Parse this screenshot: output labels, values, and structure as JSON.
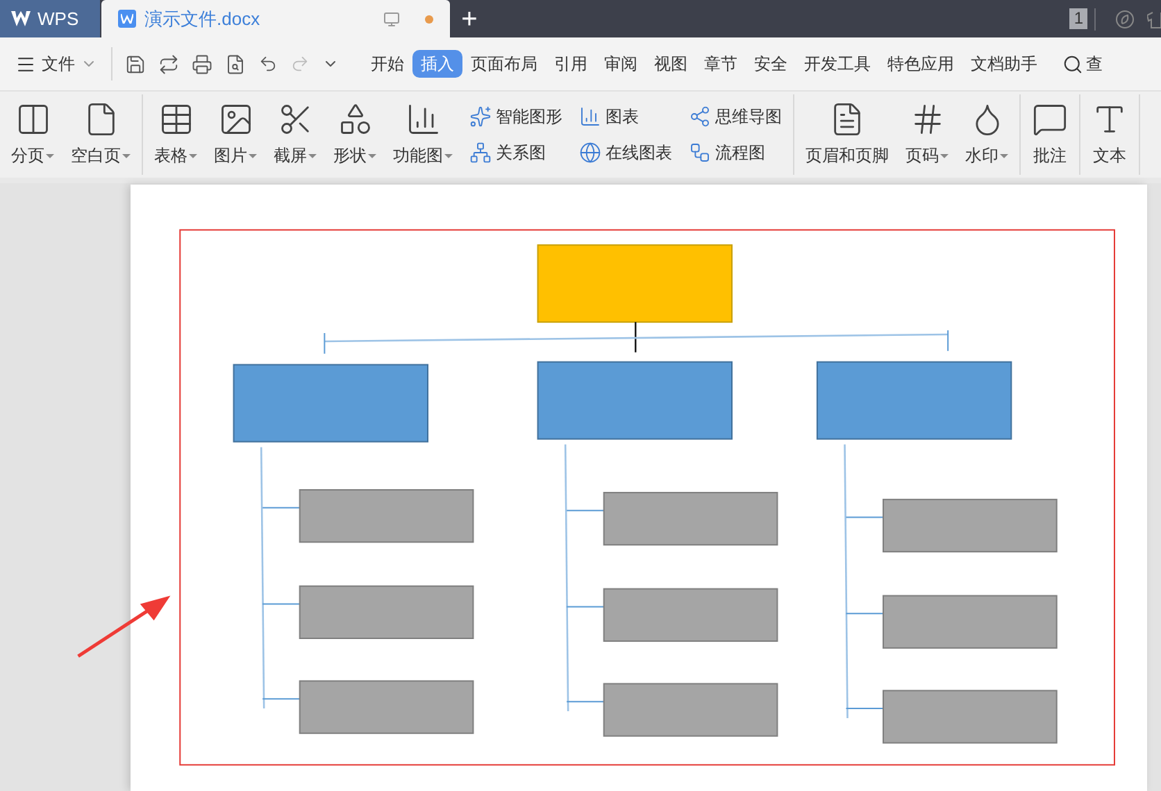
{
  "title_bar": {
    "app_tab": "WPS",
    "document_tab": {
      "title": "演示文件.docx",
      "modified": true
    },
    "new_tab": "+",
    "page_count": "1"
  },
  "menu_bar": {
    "file_menu": "文件",
    "tabs": [
      {
        "label": "开始",
        "selected": false
      },
      {
        "label": "插入",
        "selected": true
      },
      {
        "label": "页面布局",
        "selected": false
      },
      {
        "label": "引用",
        "selected": false
      },
      {
        "label": "审阅",
        "selected": false
      },
      {
        "label": "视图",
        "selected": false
      },
      {
        "label": "章节",
        "selected": false
      },
      {
        "label": "安全",
        "selected": false
      },
      {
        "label": "开发工具",
        "selected": false
      },
      {
        "label": "特色应用",
        "selected": false
      },
      {
        "label": "文档助手",
        "selected": false
      }
    ],
    "search": "查"
  },
  "ribbon": {
    "groups": [
      {
        "items": [
          {
            "kind": "large",
            "label": "分页",
            "dropdown": true
          },
          {
            "kind": "large",
            "label": "空白页",
            "dropdown": true
          }
        ]
      },
      {
        "items": [
          {
            "kind": "large",
            "label": "表格",
            "dropdown": true
          },
          {
            "kind": "large",
            "label": "图片",
            "dropdown": true
          },
          {
            "kind": "large",
            "label": "截屏",
            "dropdown": true
          },
          {
            "kind": "large",
            "label": "形状",
            "dropdown": true
          },
          {
            "kind": "large",
            "label": "功能图",
            "dropdown": true
          },
          {
            "kind": "small",
            "label": "智能图形",
            "dropdown": false
          },
          {
            "kind": "small",
            "label": "关系图",
            "dropdown": false
          },
          {
            "kind": "small",
            "label": "图表",
            "dropdown": false
          },
          {
            "kind": "small",
            "label": "在线图表",
            "dropdown": false
          },
          {
            "kind": "small",
            "label": "思维导图",
            "dropdown": false
          },
          {
            "kind": "small",
            "label": "流程图",
            "dropdown": false
          }
        ]
      },
      {
        "items": [
          {
            "kind": "large",
            "label": "页眉和页脚",
            "dropdown": false
          },
          {
            "kind": "large",
            "label": "页码",
            "dropdown": true
          },
          {
            "kind": "large",
            "label": "水印",
            "dropdown": true
          }
        ]
      },
      {
        "items": [
          {
            "kind": "large",
            "label": "批注",
            "dropdown": false
          }
        ]
      },
      {
        "items": [
          {
            "kind": "large",
            "label": "文本",
            "dropdown": false
          }
        ]
      }
    ]
  },
  "diagram": {
    "root": {
      "color": "#ffc000",
      "children": [
        {
          "color": "#5b9bd5",
          "children": [
            {
              "color": "#a5a5a5"
            },
            {
              "color": "#a5a5a5"
            },
            {
              "color": "#a5a5a5"
            }
          ]
        },
        {
          "color": "#5b9bd5",
          "children": [
            {
              "color": "#a5a5a5"
            },
            {
              "color": "#a5a5a5"
            },
            {
              "color": "#a5a5a5"
            }
          ]
        },
        {
          "color": "#5b9bd5",
          "children": [
            {
              "color": "#a5a5a5"
            },
            {
              "color": "#a5a5a5"
            },
            {
              "color": "#a5a5a5"
            }
          ]
        }
      ]
    }
  }
}
